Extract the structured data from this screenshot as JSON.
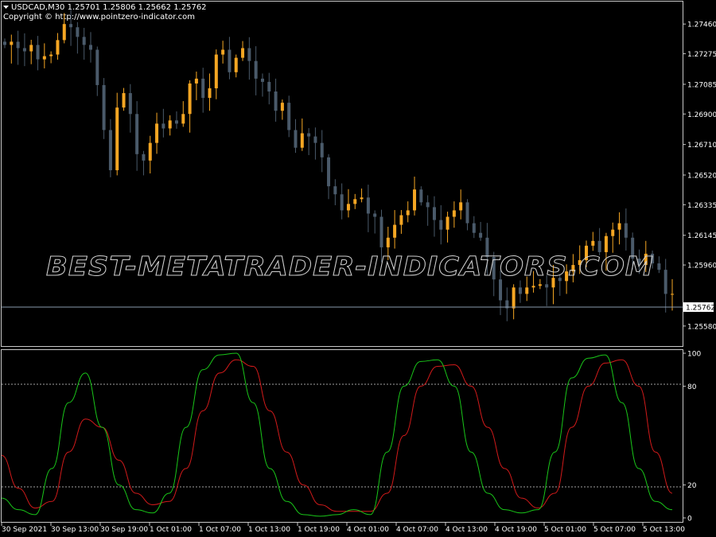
{
  "header": {
    "symbol_line": "USDCAD,M30  1.25701 1.25806 1.25662 1.25762",
    "copyright": "Copyright © http://www.pointzero-indicator.com"
  },
  "watermark": "BEST-METATRADER-INDICATORS.COM",
  "colors": {
    "background": "#000000",
    "bull_candle": "#f5a623",
    "bear_candle": "#4a5a6a",
    "stoch_main": "#19c619",
    "stoch_signal": "#d11a1a",
    "grid_line": "#a0a0a0",
    "current_price_line": "#8a9aae"
  },
  "price_axis": {
    "labels": [
      "1.27460",
      "1.27275",
      "1.27085",
      "1.26900",
      "1.26710",
      "1.26520",
      "1.26335",
      "1.26145",
      "1.25960",
      "1.25580"
    ],
    "current_price": "1.25762",
    "min": 1.2548,
    "max": 1.2757
  },
  "oscillator_axis": {
    "labels": [
      "100",
      "80",
      "20",
      "0"
    ],
    "levels": [
      20,
      80
    ],
    "min": 0,
    "max": 100
  },
  "time_axis": {
    "labels": [
      "30 Sep 2021",
      "30 Sep 13:00",
      "30 Sep 19:00",
      "1 Oct 01:00",
      "1 Oct 07:00",
      "1 Oct 13:00",
      "1 Oct 19:00",
      "4 Oct 01:00",
      "4 Oct 07:00",
      "4 Oct 13:00",
      "4 Oct 19:00",
      "5 Oct 01:00",
      "5 Oct 07:00",
      "5 Oct 13:00"
    ]
  },
  "chart_data": [
    {
      "type": "candlestick",
      "symbol": "USDCAD",
      "timeframe": "M30",
      "ylim": [
        1.2548,
        1.2757
      ],
      "close_series": [
        1.2733,
        1.2735,
        1.2731,
        1.2729,
        1.2733,
        1.2724,
        1.2726,
        1.2727,
        1.2736,
        1.2746,
        1.2744,
        1.2738,
        1.2733,
        1.273,
        1.2708,
        1.268,
        1.2655,
        1.2694,
        1.2703,
        1.269,
        1.2665,
        1.2661,
        1.2672,
        1.2684,
        1.2681,
        1.2686,
        1.2684,
        1.269,
        1.2709,
        1.2712,
        1.27,
        1.2706,
        1.2727,
        1.273,
        1.2716,
        1.2725,
        1.2731,
        1.2723,
        1.2712,
        1.271,
        1.2704,
        1.2692,
        1.2697,
        1.268,
        1.2669,
        1.2678,
        1.2676,
        1.2672,
        1.2663,
        1.2645,
        1.264,
        1.263,
        1.2634,
        1.2637,
        1.2638,
        1.2628,
        1.2626,
        1.2607,
        1.2613,
        1.2621,
        1.2627,
        1.263,
        1.2643,
        1.2635,
        1.2632,
        1.2624,
        1.2618,
        1.2626,
        1.263,
        1.2635,
        1.2622,
        1.2616,
        1.2613,
        1.2601,
        1.2587,
        1.2574,
        1.2569,
        1.2582,
        1.2578,
        1.2582,
        1.2583,
        1.2584,
        1.2582,
        1.2588,
        1.2586,
        1.2592,
        1.2596,
        1.2599,
        1.2608,
        1.2611,
        1.2604,
        1.2614,
        1.2618,
        1.2622,
        1.2613,
        1.26,
        1.2596,
        1.2603,
        1.2597,
        1.2593,
        1.2578,
        1.2578
      ],
      "current_price": 1.25762,
      "series": [
        {
          "name": "",
          "values": []
        }
      ]
    },
    {
      "type": "line",
      "ylim": [
        0,
        100
      ],
      "levels": [
        20,
        80
      ],
      "series": [
        {
          "name": "",
          "values": [
            12,
            5,
            2,
            30,
            70,
            88,
            55,
            20,
            5,
            3,
            15,
            55,
            90,
            99,
            100,
            70,
            30,
            10,
            2,
            1,
            2,
            5,
            2,
            40,
            80,
            95,
            96,
            80,
            40,
            15,
            5,
            3,
            5,
            40,
            85,
            97,
            99,
            70,
            30,
            10,
            5
          ]
        },
        {
          "name": "",
          "values": [
            38,
            18,
            6,
            10,
            40,
            60,
            55,
            35,
            15,
            8,
            10,
            30,
            65,
            88,
            96,
            92,
            65,
            40,
            20,
            8,
            4,
            4,
            4,
            15,
            50,
            80,
            92,
            93,
            80,
            55,
            30,
            12,
            6,
            15,
            55,
            80,
            94,
            96,
            80,
            40,
            15
          ]
        }
      ]
    }
  ]
}
